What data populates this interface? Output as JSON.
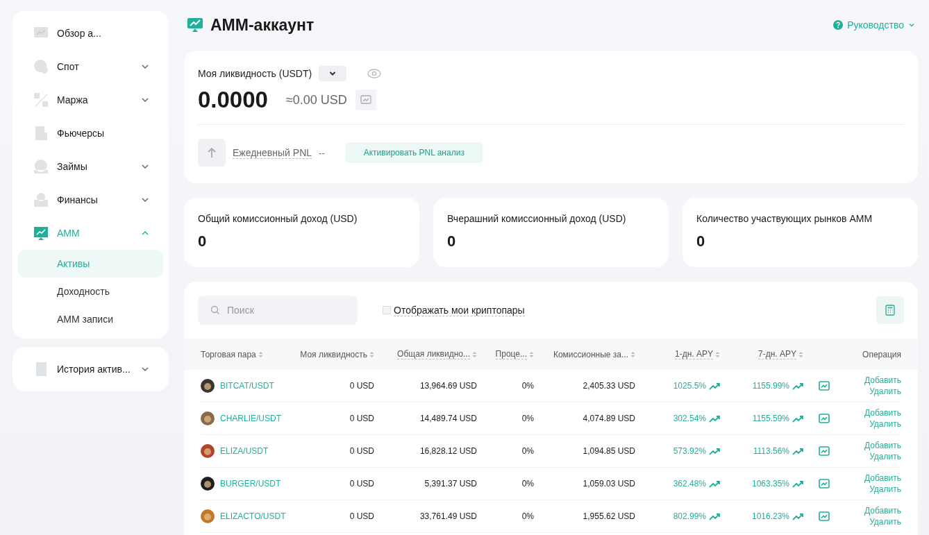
{
  "sidebar": {
    "items": [
      {
        "label": "Обзор а...",
        "expandable": false,
        "selected": false
      },
      {
        "label": "Спот",
        "expandable": true,
        "expanded": false,
        "selected": false
      },
      {
        "label": "Маржа",
        "expandable": true,
        "expanded": false,
        "selected": false
      },
      {
        "label": "Фьючерсы",
        "expandable": false,
        "selected": false
      },
      {
        "label": "Займы",
        "expandable": true,
        "expanded": false,
        "selected": false
      },
      {
        "label": "Финансы",
        "expandable": true,
        "expanded": false,
        "selected": false
      },
      {
        "label": "AMM",
        "expandable": true,
        "expanded": true,
        "selected": true,
        "children": [
          {
            "label": "Активы",
            "selected": true
          },
          {
            "label": "Доходность",
            "selected": false
          },
          {
            "label": "AMM записи",
            "selected": false
          }
        ]
      }
    ],
    "history": {
      "label": "История актив...",
      "expandable": true,
      "expanded": false,
      "selected": false
    }
  },
  "header": {
    "title": "AMM-аккаунт",
    "guide": "Руководство"
  },
  "liquidity": {
    "label": "Моя ликвидность (USDT)",
    "value": "0.0000",
    "approx": "≈0.00 USD",
    "pnl_label": "Ежедневный PNL",
    "pnl_value": "--",
    "activate_button": "Активировать PNL анализ"
  },
  "stats": [
    {
      "label": "Общий комиссионный доход (USD)",
      "value": "0"
    },
    {
      "label": "Вчерашний комиссионный доход (USD)",
      "value": "0"
    },
    {
      "label": "Количество участвующих рынков AMM",
      "value": "0"
    }
  ],
  "table": {
    "search": {
      "placeholder": "Поиск"
    },
    "filter": {
      "label": "Отображать мои криптопары",
      "checked": false
    },
    "columns": [
      {
        "label": "Торговая пара",
        "sortable": true,
        "hint": false
      },
      {
        "label": "Моя ликвидность",
        "sortable": true,
        "hint": false
      },
      {
        "label": "Общая ликвидно...",
        "sortable": true,
        "hint": true
      },
      {
        "label": "Проце...",
        "sortable": true,
        "hint": true
      },
      {
        "label": "Комиссионные за...",
        "sortable": true,
        "hint": false
      },
      {
        "label": "1-дн. APY",
        "sortable": true,
        "hint": true
      },
      {
        "label": "7-дн. APY",
        "sortable": true,
        "hint": true
      },
      {
        "label": "Операция",
        "sortable": false,
        "hint": false
      }
    ],
    "rows": [
      {
        "pair": "BITCAT/USDT",
        "color": "#3a3530",
        "my": "0 USD",
        "total": "13,964.69 USD",
        "pct": "0%",
        "fees": "2,405.33 USD",
        "apy1": "1025.5%",
        "apy7": "1155.99%",
        "add": "Добавить",
        "remove": "Удалить"
      },
      {
        "pair": "CHARLIE/USDT",
        "color": "#8a6a4a",
        "my": "0 USD",
        "total": "14,489.74 USD",
        "pct": "0%",
        "fees": "4,074.89 USD",
        "apy1": "302.54%",
        "apy7": "1155.59%",
        "add": "Добавить",
        "remove": "Удалить"
      },
      {
        "pair": "ELIZA/USDT",
        "color": "#b0452a",
        "my": "0 USD",
        "total": "16,828.12 USD",
        "pct": "0%",
        "fees": "1,094.85 USD",
        "apy1": "573.92%",
        "apy7": "1113.56%",
        "add": "Добавить",
        "remove": "Удалить"
      },
      {
        "pair": "BURGER/USDT",
        "color": "#1e1e1e",
        "my": "0 USD",
        "total": "5,391.37 USD",
        "pct": "0%",
        "fees": "1,059.03 USD",
        "apy1": "362.48%",
        "apy7": "1063.35%",
        "add": "Добавить",
        "remove": "Удалить"
      },
      {
        "pair": "ELIZACTO/USDT",
        "color": "#c0782a",
        "my": "0 USD",
        "total": "33,761.49 USD",
        "pct": "0%",
        "fees": "1,955.62 USD",
        "apy1": "802.99%",
        "apy7": "1016.23%",
        "add": "Добавить",
        "remove": "Удалить"
      }
    ]
  }
}
